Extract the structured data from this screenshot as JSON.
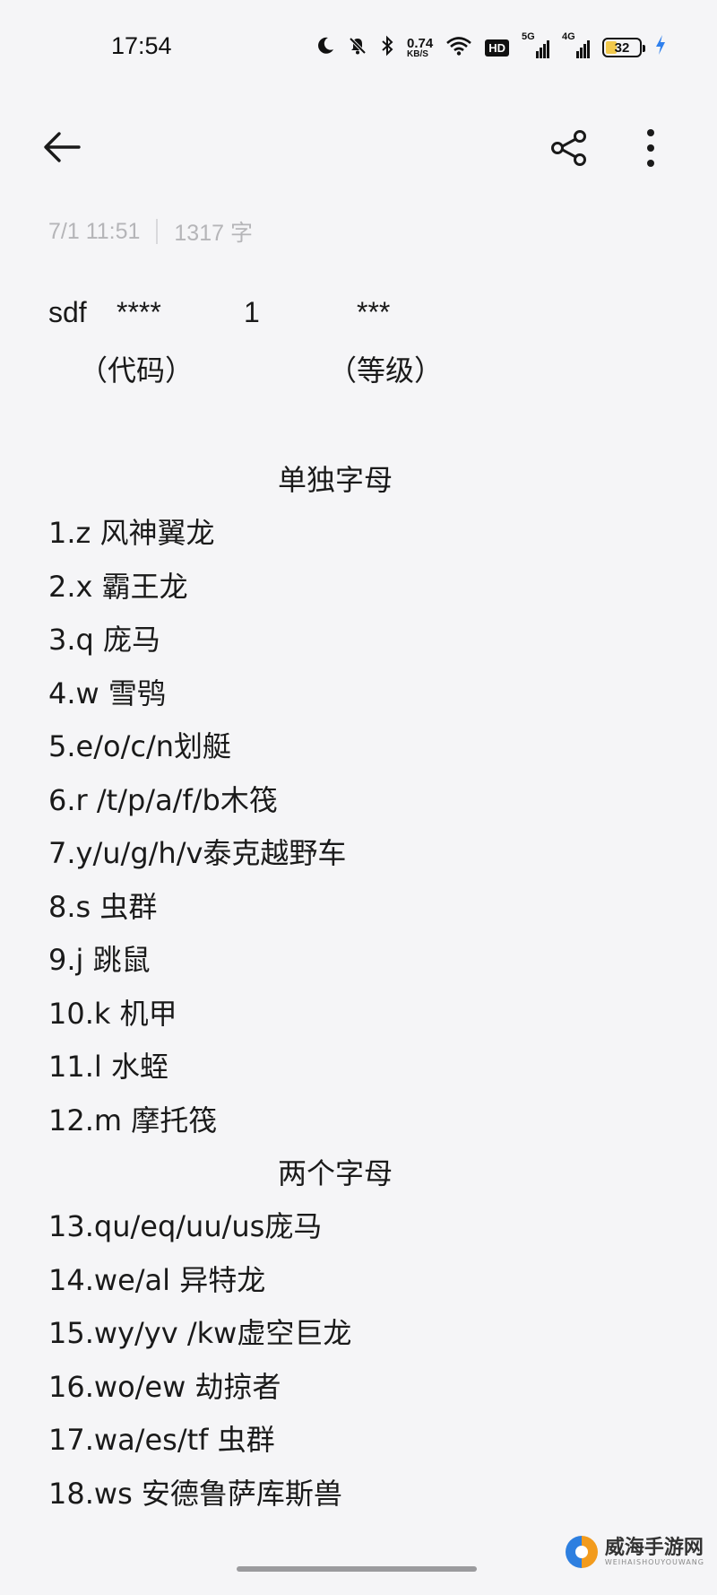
{
  "status_bar": {
    "time": "17:54",
    "net_speed_value": "0.74",
    "net_speed_unit": "KB/S",
    "hd_label": "HD",
    "sim1_gen": "5G",
    "sim2_gen": "4G",
    "battery_level": "32",
    "battery_fraction": 0.32,
    "icons": [
      "moon-icon",
      "bell-muted-icon",
      "bluetooth-icon",
      "wifi-icon",
      "charging-bolt-icon"
    ]
  },
  "toolbar": {
    "back_icon": "arrow-left-icon",
    "share_icon": "share-icon",
    "more_icon": "more-vertical-icon"
  },
  "meta": {
    "datetime": "7/1 11:51",
    "word_count": "1317 字"
  },
  "note": {
    "header_sdf": "sdf",
    "header_code_stars": "****",
    "header_num": "1",
    "header_level_stars": "***",
    "label_code": "（代码）",
    "label_level": "（等级）",
    "section_single": "单独字母",
    "single_items": [
      "1.z 风神翼龙",
      "2.x 霸王龙",
      "3.q 庞马",
      "4.w 雪鸮",
      "5.e/o/c/n划艇",
      "6.r /t/p/a/f/b木筏",
      "7.y/u/g/h/v泰克越野车",
      "8.s 虫群",
      "9.j 跳鼠",
      "10.k 机甲",
      "11.l 水蛭",
      "12.m 摩托筏"
    ],
    "section_double": "两个字母",
    "double_items": [
      "13.qu/eq/uu/us庞马",
      "14.we/al 异特龙",
      "15.wy/yv /kw虚空巨龙",
      "16.wo/ew 劫掠者",
      "17.wa/es/tf 虫群",
      "18.ws 安德鲁萨库斯兽"
    ]
  },
  "watermark": {
    "cn": "威海手游网",
    "en": "WEIHAISHOUYOUWANG"
  }
}
